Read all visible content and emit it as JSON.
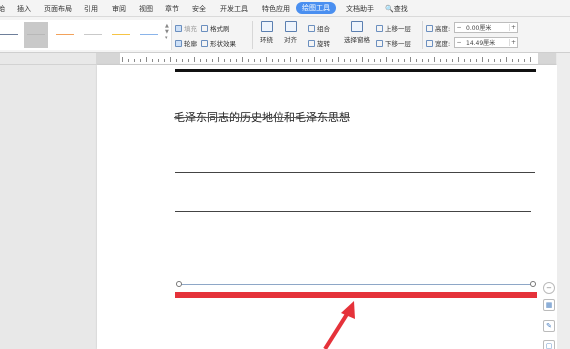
{
  "menu": {
    "tabs": [
      "插入",
      "页面布局",
      "引用",
      "审阅",
      "视图",
      "章节",
      "安全",
      "开发工具",
      "特色应用",
      "绘图工具",
      "文档助手",
      "查找"
    ],
    "active_tab": "绘图工具"
  },
  "ribbon": {
    "fill_label": "填充",
    "format_painter_label": "格式刷",
    "outline_label": "轮廓",
    "shape_effect_label": "形状效果",
    "wrap_label": "环绕",
    "align_label": "对齐",
    "group_label": "组合",
    "rotate_label": "旋转",
    "selection_pane_label": "选择窗格",
    "bring_forward_label": "上移一层",
    "send_backward_label": "下移一层",
    "height_label": "高度:",
    "width_label": "宽度:",
    "height_value": "0.00厘米",
    "width_value": "14.49厘米",
    "line_colors": [
      "#6e7f9a",
      "#b8b8b8",
      "#f2a25b",
      "#c9c9c9",
      "#f6c445",
      "#8ab4ea"
    ]
  },
  "document": {
    "title_text": "毛泽东同志的历史地位和毛泽东思想",
    "accent_color": "#e5323a"
  }
}
